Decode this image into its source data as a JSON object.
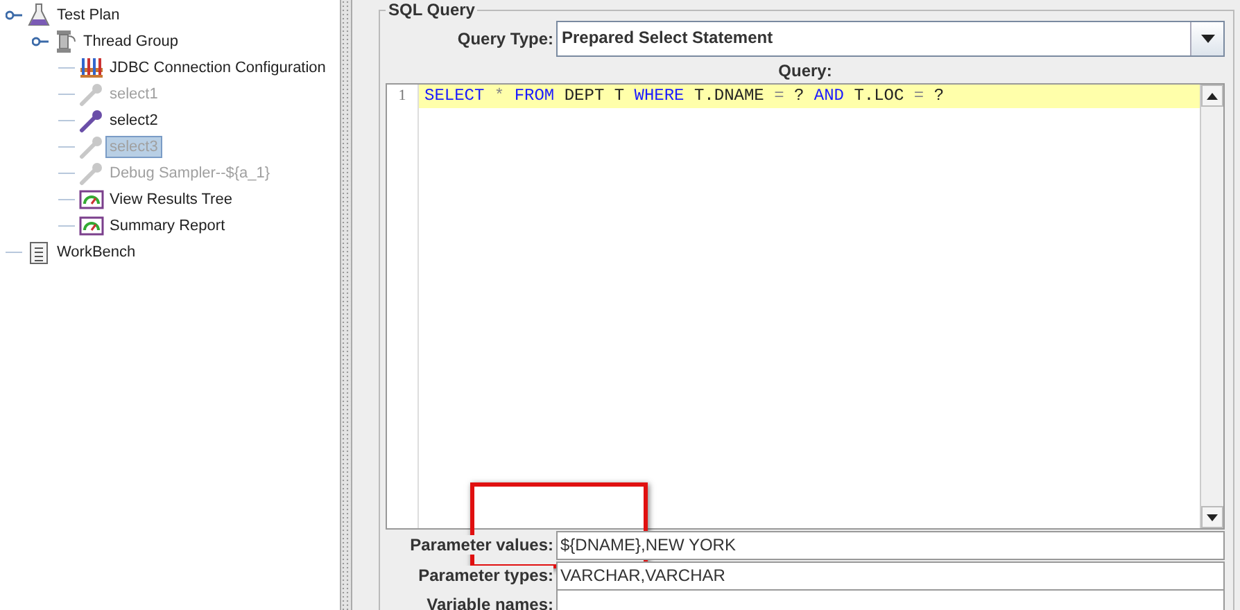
{
  "tree": [
    {
      "label": "Test Plan",
      "kind": "plan",
      "disabled": false,
      "selected": false,
      "expanded": true,
      "children": [
        {
          "label": "Thread Group",
          "kind": "threads",
          "disabled": false,
          "selected": false,
          "expanded": true,
          "children": [
            {
              "label": "JDBC Connection Configuration",
              "kind": "config",
              "disabled": false,
              "selected": false
            },
            {
              "label": "select1",
              "kind": "sampler",
              "disabled": true,
              "selected": false
            },
            {
              "label": "select2",
              "kind": "sampler",
              "disabled": false,
              "selected": false
            },
            {
              "label": "select3",
              "kind": "sampler",
              "disabled": true,
              "selected": true
            },
            {
              "label": "Debug Sampler--${a_1}",
              "kind": "sampler",
              "disabled": true,
              "selected": false
            },
            {
              "label": "View Results Tree",
              "kind": "listener",
              "disabled": false,
              "selected": false
            },
            {
              "label": "Summary Report",
              "kind": "listener",
              "disabled": false,
              "selected": false
            }
          ]
        }
      ]
    },
    {
      "label": "WorkBench",
      "kind": "workbench",
      "disabled": false,
      "selected": false
    }
  ],
  "sql_query": {
    "title": "SQL Query",
    "query_type_label": "Query Type:",
    "query_type": "Prepared Select Statement",
    "query_label": "Query:",
    "lines": [
      {
        "number": "1",
        "tokens": [
          {
            "text": "SELECT",
            "kind": "keyword"
          },
          {
            "text": " * ",
            "kind": "operator"
          },
          {
            "text": "FROM",
            "kind": "keyword"
          },
          {
            "text": " DEPT T ",
            "kind": "plain"
          },
          {
            "text": "WHERE",
            "kind": "keyword"
          },
          {
            "text": " T.DNAME ",
            "kind": "plain"
          },
          {
            "text": "= ",
            "kind": "operator"
          },
          {
            "text": "? ",
            "kind": "plain"
          },
          {
            "text": "AND",
            "kind": "keyword"
          },
          {
            "text": " T.LOC ",
            "kind": "plain"
          },
          {
            "text": "= ",
            "kind": "operator"
          },
          {
            "text": "?",
            "kind": "plain"
          }
        ]
      }
    ],
    "fields": [
      {
        "label": "Parameter values:",
        "value": "${DNAME},NEW YORK"
      },
      {
        "label": "Parameter types:",
        "value": "VARCHAR,VARCHAR"
      },
      {
        "label": "Variable names:"
      }
    ]
  }
}
